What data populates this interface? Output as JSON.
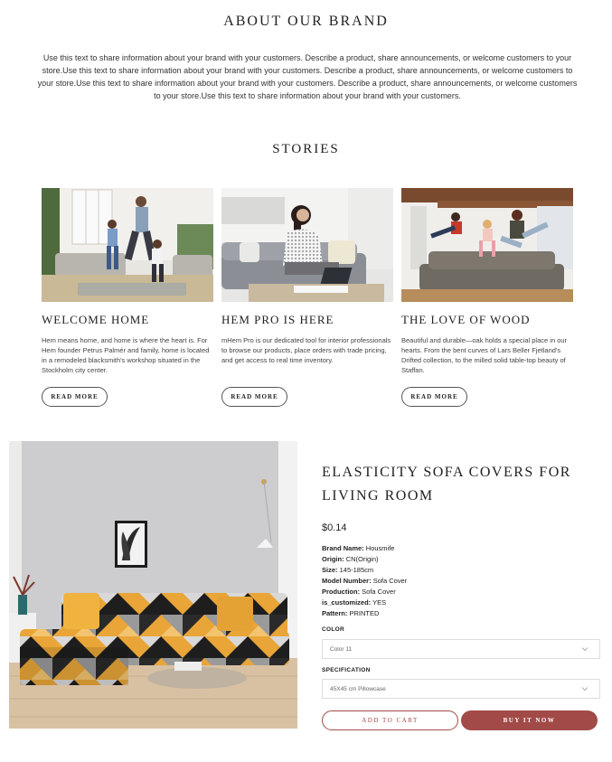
{
  "about": {
    "title": "ABOUT OUR BRAND",
    "text": "Use this text to share information about your brand with your customers. Describe a product, share announcements, or welcome customers to your store.Use this text to share information about your brand with your customers. Describe a product, share announcements, or welcome customers to your store.Use this text to share information about your brand with your customers. Describe a product, share announcements, or welcome customers to your store.Use this text to share information about your brand with your customers."
  },
  "stories": {
    "title": "STORIES",
    "items": [
      {
        "title": "WELCOME HOME",
        "text": "Hem means home, and home is where the heart is. For Hem founder Petrus Palmér and family, home is located in a remodeled blacksmith's workshop situated in the Stockholm city center.",
        "button": "READ MORE"
      },
      {
        "title": "HEM PRO IS HERE",
        "text": "mHem Pro is our dedicated tool for interior professionals to browse our products, place orders with trade pricing, and get access to real time inventory.",
        "button": "READ MORE"
      },
      {
        "title": "THE LOVE OF WOOD",
        "text": "Beautiful and durable—oak holds a special place in our hearts. From the bent curves of Lars Beller Fjetland's Drifted collection, to the milled solid table-top beauty of Staffan.",
        "button": "READ MORE"
      }
    ]
  },
  "product": {
    "title": "ELASTICITY SOFA COVERS FOR LIVING ROOM",
    "price": "$0.14",
    "specs": [
      {
        "label": "Brand Name:",
        "value": "Housmife"
      },
      {
        "label": "Origin:",
        "value": "CN(Origin)"
      },
      {
        "label": "Size:",
        "value": "145-185cm"
      },
      {
        "label": "Model Number:",
        "value": "Sofa Cover"
      },
      {
        "label": "Production:",
        "value": "Sofa Cover"
      },
      {
        "label": "is_customized:",
        "value": "YES"
      },
      {
        "label": "Pattern:",
        "value": "PRINTED"
      }
    ],
    "color_label": "COLOR",
    "color_value": "Color 11",
    "spec_label": "SPECIFICATION",
    "spec_value": "45X45 cm Pillowcase",
    "add_to_cart": "ADD TO CART",
    "buy_now": "BUY IT NOW"
  },
  "colors": {
    "accent": "#a24a47"
  }
}
